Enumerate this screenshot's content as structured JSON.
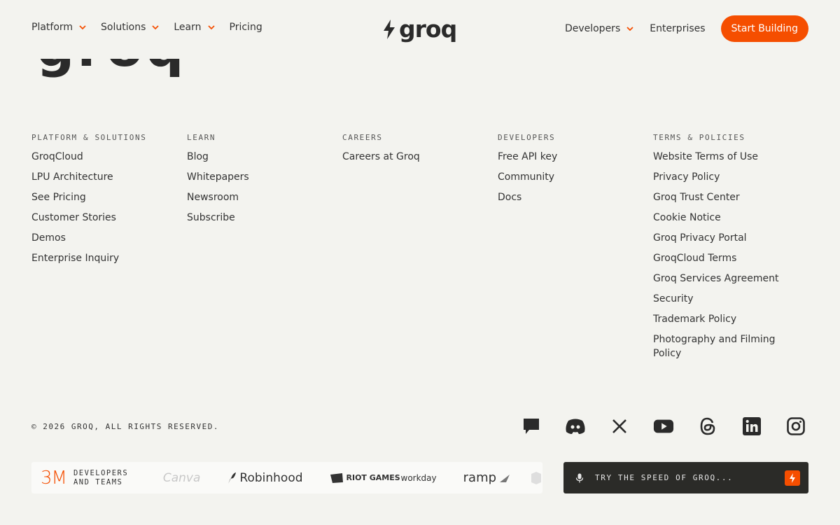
{
  "header": {
    "nav_left": [
      {
        "label": "Platform",
        "icon": "chevron-down-icon"
      },
      {
        "label": "Solutions",
        "icon": "chevron-down-icon"
      },
      {
        "label": "Learn",
        "icon": "chevron-down-icon"
      },
      {
        "label": "Pricing"
      }
    ],
    "logo_text": "groq",
    "nav_right": [
      {
        "label": "Developers",
        "icon": "chevron-down-icon"
      },
      {
        "label": "Enterprises"
      }
    ],
    "cta_label": "Start Building"
  },
  "big_wordmark": "groq",
  "columns": [
    {
      "title": "PLATFORM & SOLUTIONS",
      "links": [
        "GroqCloud",
        "LPU Architecture",
        "See Pricing",
        "Customer Stories",
        "Demos",
        "Enterprise Inquiry"
      ]
    },
    {
      "title": "LEARN",
      "links": [
        "Blog",
        "Whitepapers",
        "Newsroom",
        "Subscribe"
      ]
    },
    {
      "title": "CAREERS",
      "links": [
        "Careers at Groq"
      ]
    },
    {
      "title": "DEVELOPERS",
      "links": [
        "Free API key",
        "Community",
        "Docs"
      ]
    },
    {
      "title": "TERMS & POLICIES",
      "links": [
        "Website Terms of Use",
        "Privacy Policy",
        "Groq Trust Center",
        "Cookie Notice",
        "Groq Privacy Portal",
        "GroqCloud Terms",
        "Groq Services Agreement",
        "Security",
        "Trademark Policy",
        "Photography and Filming Policy"
      ]
    }
  ],
  "copyright": "© 2026 GROQ, ALL RIGHTS RESERVED.",
  "social_icons": [
    "chat-icon",
    "discord-icon",
    "x-icon",
    "youtube-icon",
    "threads-icon",
    "linkedin-icon",
    "instagram-icon"
  ],
  "strip": {
    "stat": "3M",
    "stat_label": "DEVELOPERS AND TEAMS",
    "brands": [
      "Canva",
      "Robinhood",
      "RIOT GAMES",
      "workday",
      "ramp"
    ]
  },
  "try_box": {
    "placeholder": "TRY THE SPEED OF GROQ...",
    "icon": "microphone-icon",
    "button_icon": "bolt-icon"
  },
  "colors": {
    "accent": "#f54e00",
    "background": "#f3f3ef",
    "dark": "#2b2b28"
  }
}
